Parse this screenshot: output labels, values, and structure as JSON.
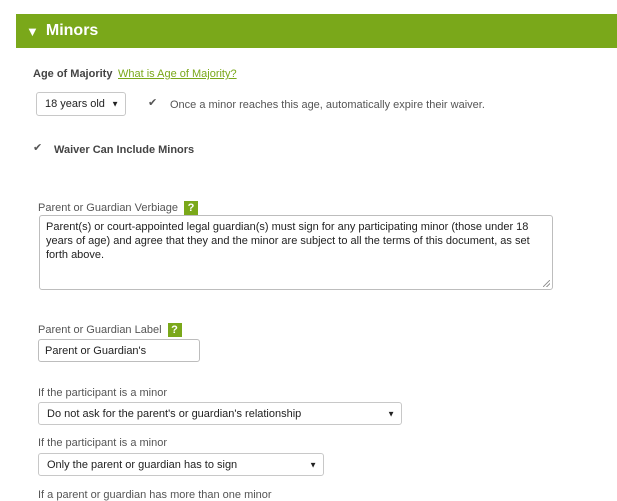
{
  "section": {
    "title": "Minors",
    "toggle_icon": "triangle-down"
  },
  "age_of_majority": {
    "label": "Age of Majority",
    "help_link": "What is Age of Majority?",
    "selected": "18 years old",
    "auto_expire_checked": true,
    "auto_expire_label": "Once a minor reaches this age, automatically expire their waiver."
  },
  "waiver_minors": {
    "checked": true,
    "label": "Waiver Can Include Minors"
  },
  "verbiage": {
    "label": "Parent or Guardian Verbiage",
    "help": "?",
    "text": "Parent(s) or court-appointed legal guardian(s) must sign for any participating minor (those under 18 years of age) and agree that they and the minor are subject to all the terms of this document, as set forth above."
  },
  "guardian_label": {
    "label": "Parent or Guardian Label",
    "help": "?",
    "value": "Parent or Guardian's"
  },
  "relationship": {
    "label": "If the participant is a minor",
    "selected": "Do not ask for the parent's or guardian's relationship"
  },
  "signer": {
    "label": "If the participant is a minor",
    "selected": "Only the parent or guardian has to sign"
  },
  "multiple_minors": {
    "label": "If a parent or guardian has more than one minor"
  }
}
